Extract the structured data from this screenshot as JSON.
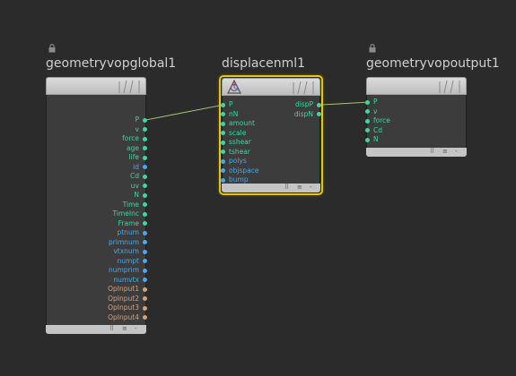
{
  "colors": {
    "background": "#2b2b2b",
    "wire": "#a6cc7a",
    "port_green": "#3fd6a0",
    "port_blue": "#4aa8e8",
    "port_tan": "#d4a27a",
    "selected_outline": "#e6c800"
  },
  "nodes": [
    {
      "id": "global",
      "title": "geometryvopglobal1",
      "locked": true,
      "inputs": [],
      "outputs": [
        {
          "label": "P",
          "type": "green"
        },
        {
          "label": "v",
          "type": "green"
        },
        {
          "label": "force",
          "type": "green"
        },
        {
          "label": "age",
          "type": "green"
        },
        {
          "label": "life",
          "type": "green"
        },
        {
          "label": "id",
          "type": "blue"
        },
        {
          "label": "Cd",
          "type": "green"
        },
        {
          "label": "uv",
          "type": "green"
        },
        {
          "label": "N",
          "type": "green"
        },
        {
          "label": "Time",
          "type": "green"
        },
        {
          "label": "TimeInc",
          "type": "green"
        },
        {
          "label": "Frame",
          "type": "green"
        },
        {
          "label": "ptnum",
          "type": "blue"
        },
        {
          "label": "primnum",
          "type": "blue"
        },
        {
          "label": "vtxnum",
          "type": "blue"
        },
        {
          "label": "numpt",
          "type": "blue"
        },
        {
          "label": "numprim",
          "type": "blue"
        },
        {
          "label": "numvtx",
          "type": "blue"
        },
        {
          "label": "OpInput1",
          "type": "tan"
        },
        {
          "label": "OpInput2",
          "type": "tan"
        },
        {
          "label": "OpInput3",
          "type": "tan"
        },
        {
          "label": "OpInput4",
          "type": "tan"
        }
      ],
      "footer": [
        "⠿",
        "≡",
        "‐"
      ]
    },
    {
      "id": "displace",
      "title": "displacenml1",
      "locked": false,
      "selected": true,
      "icon": "displace-icon",
      "inputs": [
        {
          "label": "P",
          "type": "green"
        },
        {
          "label": "nN",
          "type": "green"
        },
        {
          "label": "amount",
          "type": "green"
        },
        {
          "label": "scale",
          "type": "green"
        },
        {
          "label": "sshear",
          "type": "green"
        },
        {
          "label": "tshear",
          "type": "green"
        },
        {
          "label": "polys",
          "type": "blue"
        },
        {
          "label": "objspace",
          "type": "blue"
        },
        {
          "label": "bump",
          "type": "blue"
        }
      ],
      "outputs": [
        {
          "label": "dispP",
          "type": "green"
        },
        {
          "label": "dispN",
          "type": "green"
        }
      ],
      "footer": [
        "⠿",
        "≡",
        "‐"
      ]
    },
    {
      "id": "output",
      "title": "geometryvopoutput1",
      "locked": true,
      "inputs": [
        {
          "label": "P",
          "type": "green"
        },
        {
          "label": "v",
          "type": "green"
        },
        {
          "label": "force",
          "type": "green"
        },
        {
          "label": "Cd",
          "type": "green"
        },
        {
          "label": "N",
          "type": "green"
        }
      ],
      "outputs": [],
      "footer": [
        "⠿",
        "≡",
        "‐"
      ]
    }
  ],
  "connections": [
    {
      "from": "global.P",
      "to": "displace.P"
    },
    {
      "from": "displace.dispP",
      "to": "output.P"
    }
  ]
}
